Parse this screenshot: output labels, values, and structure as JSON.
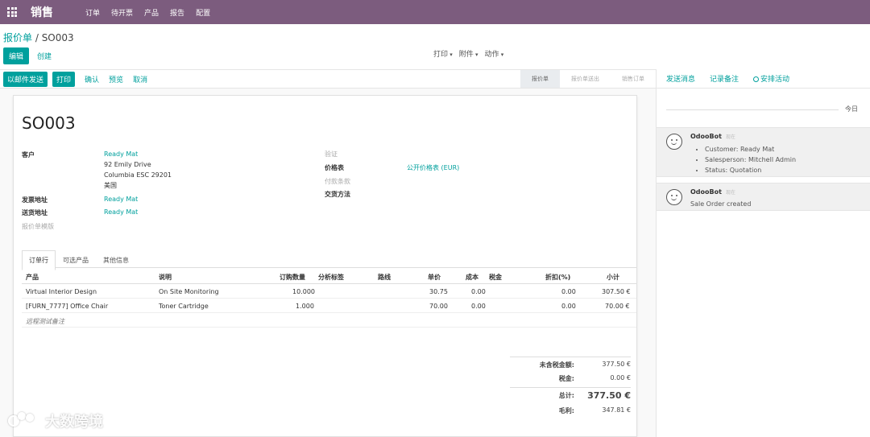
{
  "navbar": {
    "brand": "销售",
    "items": [
      "订单",
      "待开票",
      "产品",
      "报告",
      "配置"
    ]
  },
  "breadcrumb": {
    "parent": "报价单",
    "separator": " / ",
    "current": "SO003"
  },
  "control_panel": {
    "edit_label": "编辑",
    "create_label": "创建",
    "print_label": "打印",
    "attachment_label": "附件",
    "action_label": "动作"
  },
  "statusbar": {
    "send_email_label": "以邮件发送",
    "print_label": "打印",
    "confirm_label": "确认",
    "preview_label": "预览",
    "cancel_label": "取消",
    "stages": [
      "报价单",
      "报价单送出",
      "销售订单"
    ],
    "active_stage": "报价单"
  },
  "chatter": {
    "send_message_label": "发送消息",
    "log_note_label": "记录备注",
    "schedule_activity_label": "安排活动",
    "date_separator": "今日",
    "messages": [
      {
        "author": "OdooBot",
        "date": "现在",
        "tracking": [
          "Customer: Ready Mat",
          "Salesperson: Mitchell Admin",
          "Status: Quotation"
        ]
      },
      {
        "author": "OdooBot",
        "date": "现在",
        "text": "Sale Order created"
      }
    ]
  },
  "order": {
    "name": "SO003",
    "customer_label": "客户",
    "customer_name": "Ready Mat",
    "customer_address": [
      "92 Emily Drive",
      "Columbia ESC 29201",
      "美国"
    ],
    "invoice_address_label": "发票地址",
    "invoice_address": "Ready Mat",
    "delivery_address_label": "送货地址",
    "delivery_address": "Ready Mat",
    "template_label": "报价单模版",
    "validity_label": "验证",
    "pricelist_label": "价格表",
    "pricelist": "公开价格表 (EUR)",
    "payment_terms_label": "付款条款",
    "incoterm_label": "交货方法"
  },
  "tabs": {
    "order_lines": "订单行",
    "optional_products": "可选产品",
    "other_info": "其他信息"
  },
  "table": {
    "headers": {
      "product": "产品",
      "description": "说明",
      "quantity": "订购数量",
      "analytic_tags": "分析标签",
      "route": "路线",
      "unit_price": "单价",
      "cost": "成本",
      "taxes": "税金",
      "discount": "折扣(%)",
      "subtotal": "小计"
    },
    "rows": [
      {
        "product": "Virtual Interior Design",
        "description": "On Site Monitoring",
        "quantity": "10.000",
        "unit_price": "30.75",
        "cost": "0.00",
        "discount": "0.00",
        "subtotal": "307.50 €"
      },
      {
        "product": "[FURN_7777] Office Chair",
        "description": "Toner Cartridge",
        "quantity": "1.000",
        "unit_price": "70.00",
        "cost": "0.00",
        "discount": "0.00",
        "subtotal": "70.00 €"
      }
    ],
    "note": "远程测试备注"
  },
  "totals": {
    "untaxed_label": "未含税金额:",
    "untaxed": "377.50 €",
    "taxes_label": "税金:",
    "taxes": "0.00 €",
    "total_label": "总计:",
    "total": "377.50 €",
    "margin_label": "毛利:",
    "margin": "347.81 €"
  },
  "watermark": "大数跨境",
  "colors": {
    "navbar": "#7c5c7e",
    "primary": "#00a09d"
  }
}
